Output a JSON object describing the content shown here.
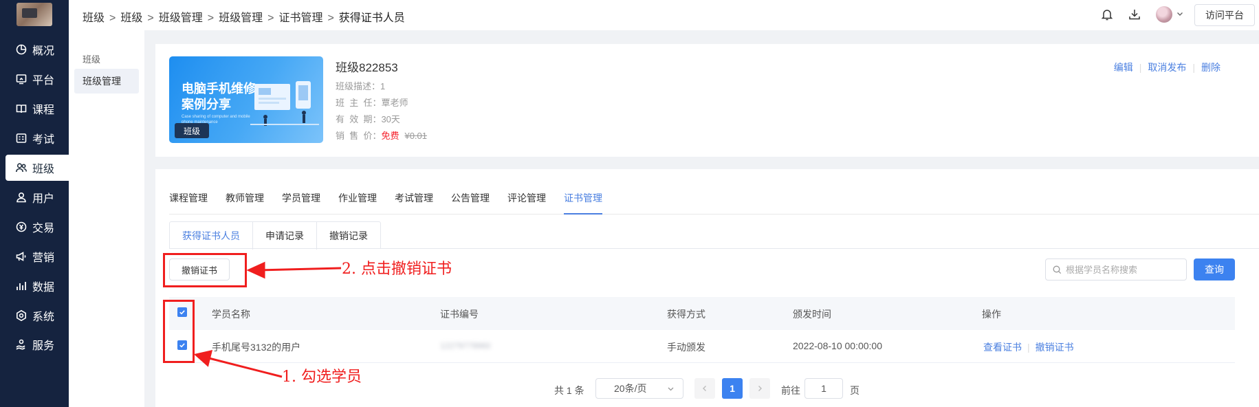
{
  "sidebar": {
    "items": [
      {
        "label": "概况",
        "icon": "pie-chart-icon"
      },
      {
        "label": "平台",
        "icon": "monitor-icon"
      },
      {
        "label": "课程",
        "icon": "book-icon"
      },
      {
        "label": "考试",
        "icon": "exam-icon"
      },
      {
        "label": "班级",
        "icon": "class-users-icon",
        "active": true
      },
      {
        "label": "用户",
        "icon": "user-icon"
      },
      {
        "label": "交易",
        "icon": "transaction-icon"
      },
      {
        "label": "营销",
        "icon": "megaphone-icon"
      },
      {
        "label": "数据",
        "icon": "bar-data-icon"
      },
      {
        "label": "系统",
        "icon": "gear-icon"
      },
      {
        "label": "服务",
        "icon": "service-icon"
      }
    ]
  },
  "header": {
    "breadcrumb": [
      "班级",
      "班级",
      "班级管理",
      "班级管理",
      "证书管理",
      "获得证书人员"
    ],
    "visit_label": "访问平台"
  },
  "subnav": {
    "title": "班级",
    "item": "班级管理"
  },
  "class_info": {
    "banner_title": "电脑手机维修案例分享",
    "banner_sub": "Case sharing of computer and mobile phone maintenance",
    "banner_tag": "班级",
    "name": "班级822853",
    "desc_label": "班级描述：",
    "desc_value": "1",
    "teacher_label": "班  主  任：",
    "teacher_value": "覃老师",
    "validity_label": "有  效  期：",
    "validity_value": "30天",
    "price_label": "销  售  价：",
    "price_free": "免费",
    "price_old": "¥0.01",
    "actions": {
      "edit": "编辑",
      "unpublish": "取消发布",
      "delete": "删除"
    }
  },
  "tabs": [
    "课程管理",
    "教师管理",
    "学员管理",
    "作业管理",
    "考试管理",
    "公告管理",
    "评论管理",
    "证书管理"
  ],
  "active_tab": "证书管理",
  "subtabs": [
    "获得证书人员",
    "申请记录",
    "撤销记录"
  ],
  "toolbar": {
    "revoke_label": "撤销证书",
    "search_placeholder": "根据学员名称搜索",
    "query_label": "查询"
  },
  "table": {
    "columns": [
      "学员名称",
      "证书编号",
      "获得方式",
      "颁发时间",
      "操作"
    ],
    "rows": [
      {
        "name": "手机尾号3132的用户",
        "cert_no": "12279779960",
        "method": "手动颁发",
        "issued": "2022-08-10 00:00:00",
        "ops": {
          "view": "查看证书",
          "revoke": "撤销证书"
        }
      }
    ]
  },
  "pagination": {
    "total": "共 1 条",
    "page_size": "20条/页",
    "current": "1",
    "goto_label": "前往",
    "goto_value": "1",
    "page_label": "页"
  },
  "annotations": {
    "step1": "1. 勾选学员",
    "step2": "2. 点击撤销证书",
    "color": "#f01e1e"
  }
}
